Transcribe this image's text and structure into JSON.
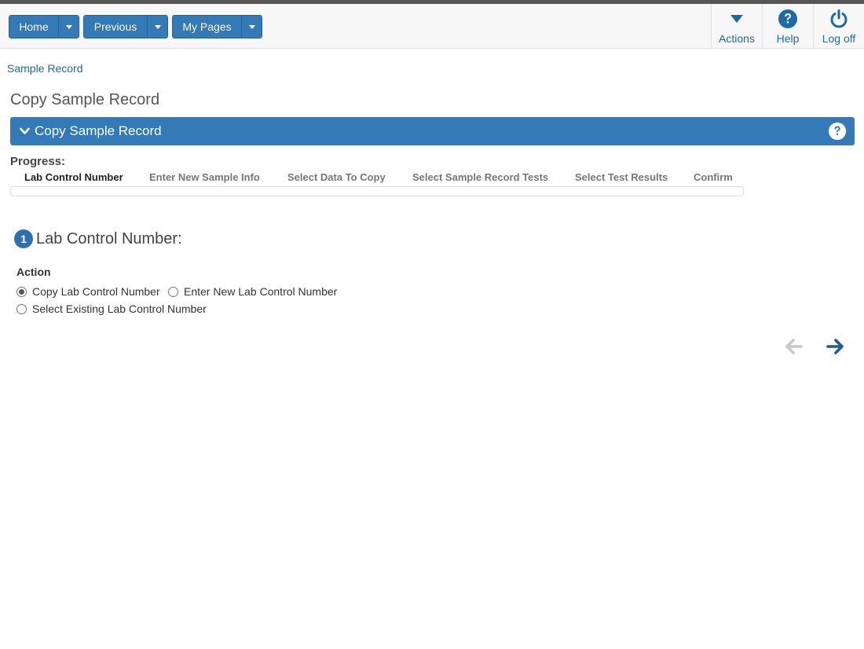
{
  "topbar": {
    "home_label": "Home",
    "previous_label": "Previous",
    "mypages_label": "My Pages",
    "actions_label": "Actions",
    "help_label": "Help",
    "logoff_label": "Log off"
  },
  "breadcrumb": "Sample Record",
  "page_title": "Copy Sample Record",
  "panel": {
    "title": "Copy Sample Record"
  },
  "progress": {
    "label": "Progress:",
    "fraction": 0,
    "steps": [
      {
        "label": "Lab Control Number",
        "active": true
      },
      {
        "label": "Enter New Sample Info",
        "active": false
      },
      {
        "label": "Select Data To Copy",
        "active": false
      },
      {
        "label": "Select Sample Record Tests",
        "active": false
      },
      {
        "label": "Select Test Results",
        "active": false
      },
      {
        "label": "Confirm",
        "active": false
      }
    ]
  },
  "section": {
    "number": "1",
    "title": "Lab Control Number:"
  },
  "action": {
    "label": "Action",
    "options": [
      {
        "label": "Copy Lab Control Number",
        "selected": true
      },
      {
        "label": "Enter New Lab Control Number",
        "selected": false
      },
      {
        "label": "Select Existing Lab Control Number",
        "selected": false
      }
    ]
  },
  "colors": {
    "primary": "#337ab7",
    "link": "#1d6aa5",
    "arrow_disabled": "#c8c8c8",
    "arrow_enabled": "#1d5a96"
  },
  "icons": {
    "actions": "caret-down-icon",
    "help": "question-circle-icon",
    "logoff": "power-icon",
    "back": "arrow-left-icon",
    "next": "arrow-right-icon"
  }
}
